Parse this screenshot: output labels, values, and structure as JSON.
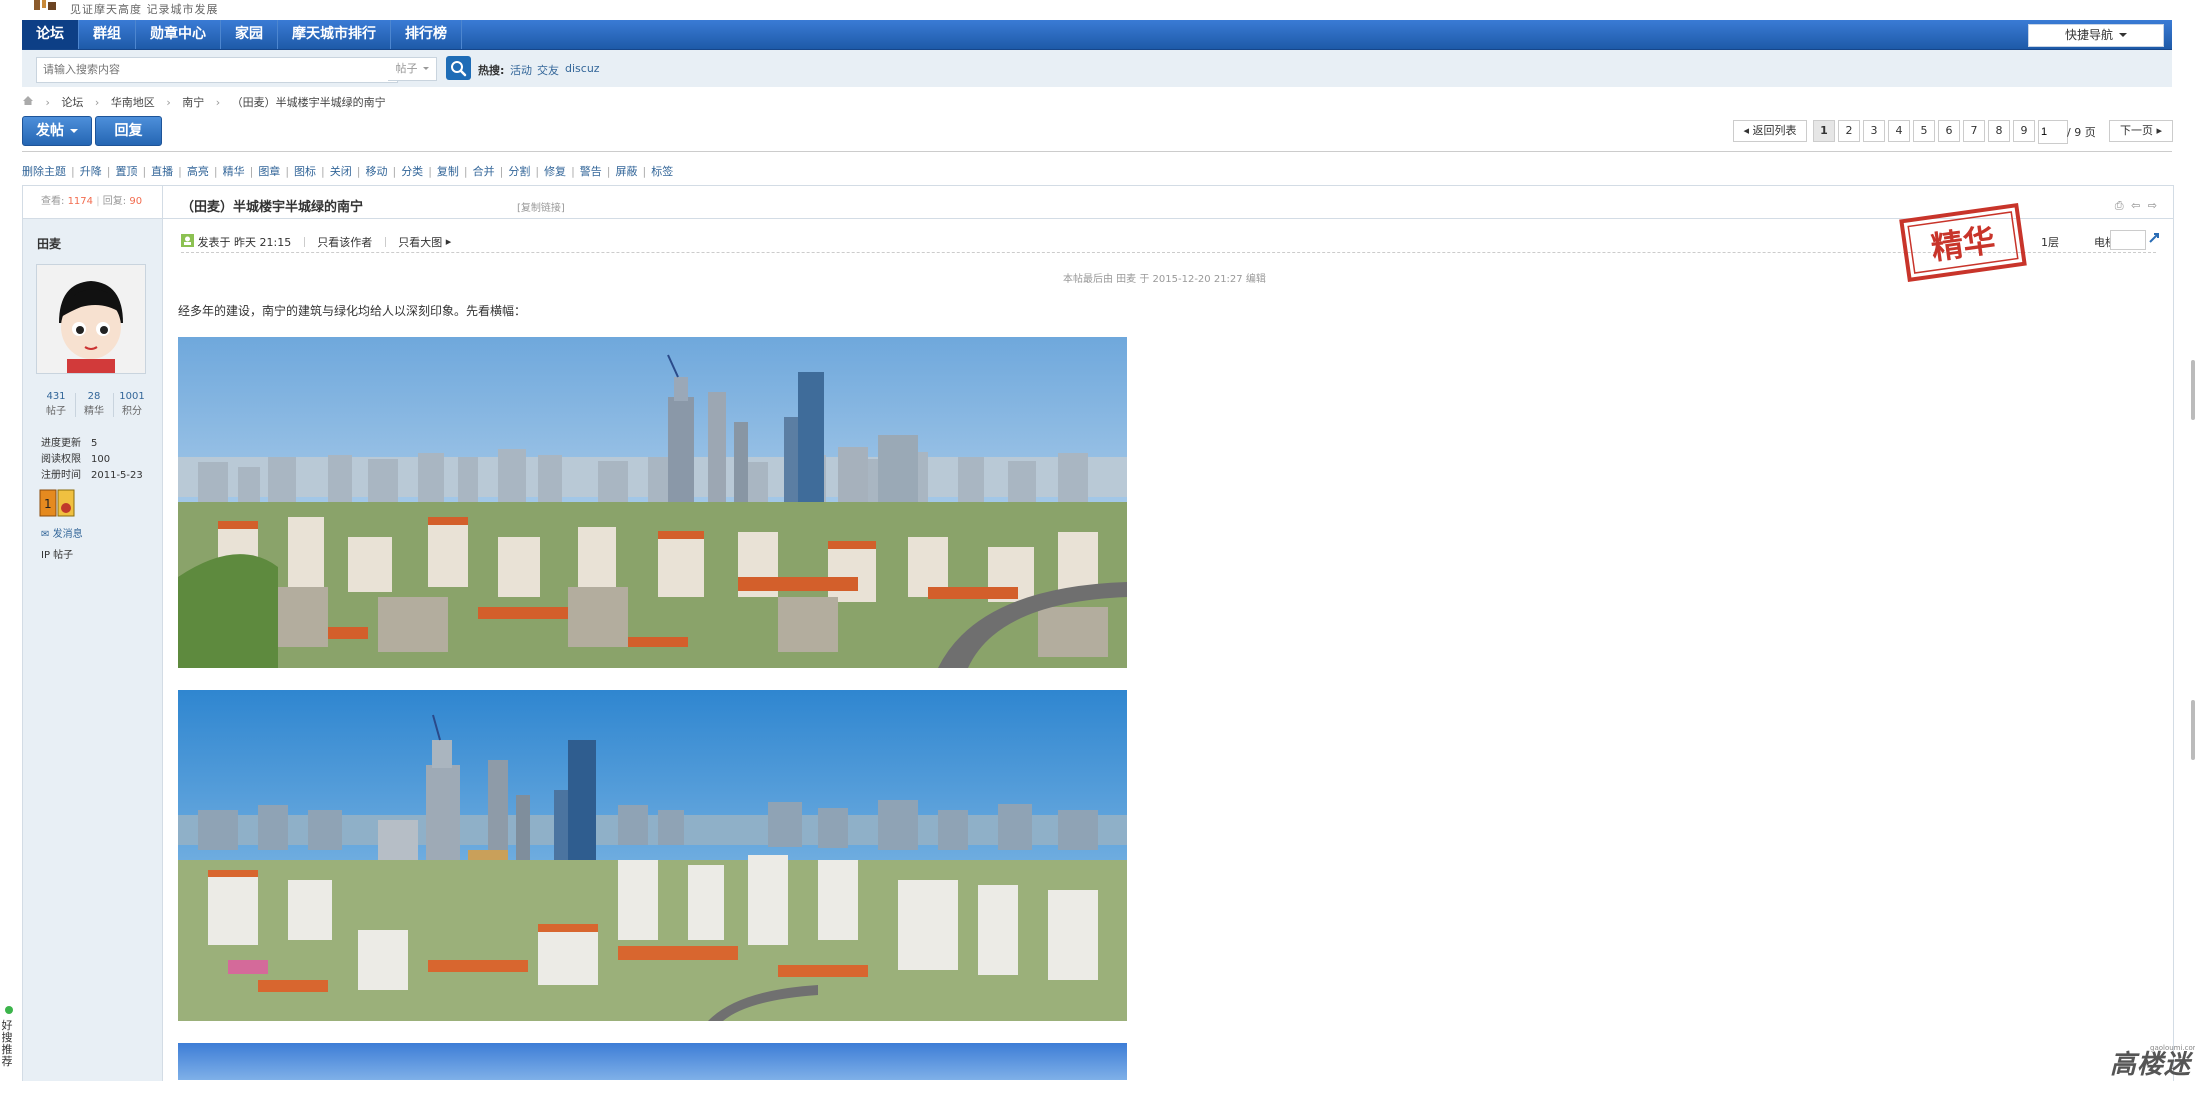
{
  "site": {
    "slogan": "见证摩天高度 记录城市发展",
    "watermark": "高楼迷",
    "watermark_sub": "gaoloumi.com"
  },
  "nav": {
    "items": [
      {
        "label": "论坛",
        "active": true
      },
      {
        "label": "群组"
      },
      {
        "label": "勋章中心"
      },
      {
        "label": "家园"
      },
      {
        "label": "摩天城市排行"
      },
      {
        "label": "排行榜"
      }
    ],
    "quick_nav": "快捷导航"
  },
  "search": {
    "placeholder": "请输入搜索内容",
    "type": "帖子",
    "hot_label": "热搜:",
    "hot_links": [
      "活动",
      "交友",
      "discuz"
    ]
  },
  "breadcrumb": [
    "论坛",
    "华南地区",
    "南宁",
    "（田麦）半城楼宇半城绿的南宁"
  ],
  "actions": {
    "post_label": "发帖",
    "reply_label": "回复"
  },
  "pager": {
    "back": "返回列表",
    "pages": [
      "1",
      "2",
      "3",
      "4",
      "5",
      "6",
      "7",
      "8",
      "9"
    ],
    "current": "1",
    "input_value": "1",
    "total": "/ 9 页",
    "next": "下一页"
  },
  "mod_tools": [
    "删除主题",
    "升降",
    "置顶",
    "直播",
    "高亮",
    "精华",
    "图章",
    "图标",
    "关闭",
    "移动",
    "分类",
    "复制",
    "合并",
    "分割",
    "修复",
    "警告",
    "屏蔽",
    "标签"
  ],
  "thread": {
    "views_label": "查看:",
    "views": "1174",
    "replies_label": "回复:",
    "replies": "90",
    "title": "（田麦）半城楼宇半城绿的南宁",
    "copy_link": "[复制链接]"
  },
  "author": {
    "name": "田麦",
    "stats": [
      {
        "value": "431",
        "label": "帖子"
      },
      {
        "value": "28",
        "label": "精华"
      },
      {
        "value": "1001",
        "label": "积分"
      }
    ],
    "info": [
      {
        "k": "进度更新",
        "v": "5"
      },
      {
        "k": "阅读权限",
        "v": "100"
      },
      {
        "k": "注册时间",
        "v": "2011-5-23"
      }
    ],
    "send_msg": "发消息",
    "ip_post": "IP 帖子"
  },
  "post": {
    "posted": "发表于 昨天 21:15",
    "only_author": "只看该作者",
    "big_image": "只看大图",
    "floor": "1层",
    "elevator": "电梯直达",
    "stamp": "精华",
    "edit_note": "本帖最后由 田麦 于 2015-12-20 21:27 编辑",
    "intro": "经多年的建设，南宁的建筑与绿化均给人以深刻印象。先看横幅："
  },
  "sidebar_tab": "好搜推荐",
  "colors": {
    "nav_blue": "#1e5aa8",
    "link": "#336699",
    "count_orange": "#f26c4f",
    "stamp_red": "#c8342a"
  }
}
